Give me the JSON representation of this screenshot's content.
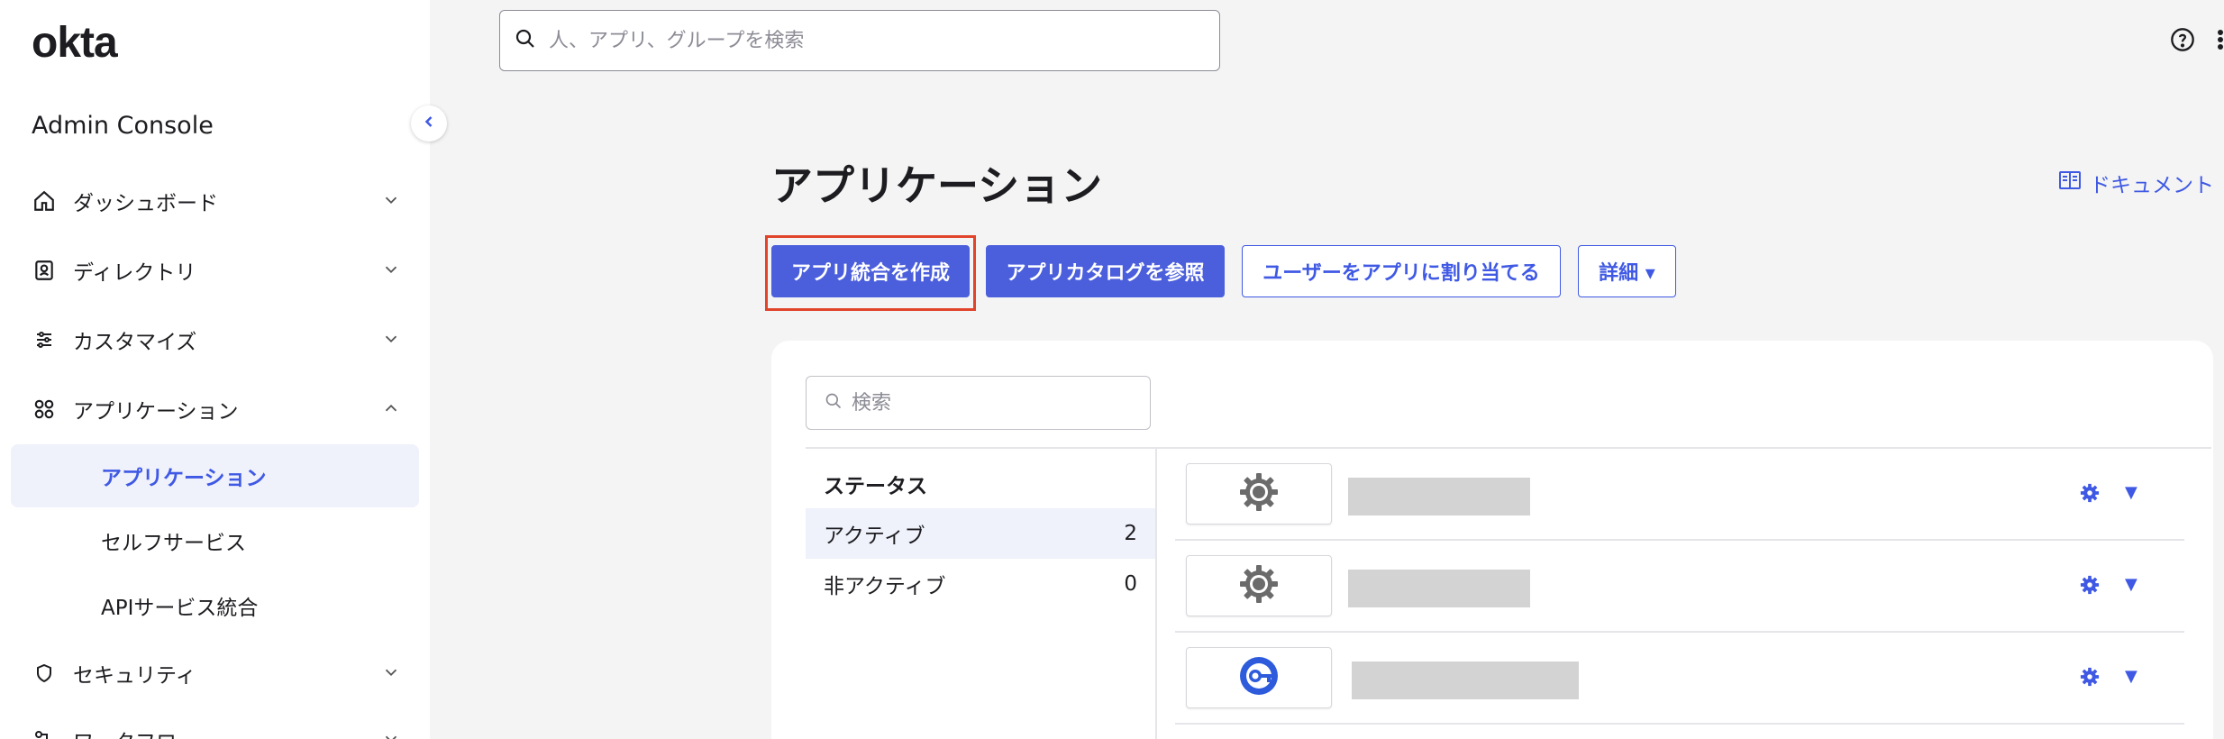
{
  "brand": {
    "logo_text": "okta",
    "console_title": "Admin Console"
  },
  "sidebar": {
    "items": [
      {
        "label": "ダッシュボード",
        "icon": "home-icon",
        "expanded": false
      },
      {
        "label": "ディレクトリ",
        "icon": "directory-icon",
        "expanded": false
      },
      {
        "label": "カスタマイズ",
        "icon": "sliders-icon",
        "expanded": false
      },
      {
        "label": "アプリケーション",
        "icon": "apps-grid-icon",
        "expanded": true
      },
      {
        "label": "セキュリティ",
        "icon": "shield-icon",
        "expanded": false
      },
      {
        "label": "ワークフロー",
        "icon": "workflow-icon",
        "expanded": false
      }
    ],
    "sub_items": [
      {
        "label": "アプリケーション",
        "active": true
      },
      {
        "label": "セルフサービス",
        "active": false
      },
      {
        "label": "APIサービス統合",
        "active": false
      }
    ]
  },
  "search": {
    "placeholder": "人、アプリ、グループを検索"
  },
  "page": {
    "title": "アプリケーション",
    "doc_link": "ドキュメント",
    "buttons": {
      "create": "アプリ統合を作成",
      "browse": "アプリカタログを参照",
      "assign": "ユーザーをアプリに割り当てる",
      "more": "詳細 ▾"
    }
  },
  "apps_panel": {
    "search_placeholder": "検索",
    "status_title": "ステータス",
    "statuses": [
      {
        "label": "アクティブ",
        "count": "2"
      },
      {
        "label": "非アクティブ",
        "count": "0"
      }
    ],
    "apps": [
      {
        "logo": "gear-icon"
      },
      {
        "logo": "gear-icon"
      },
      {
        "logo": "okta-key-icon"
      }
    ]
  },
  "colors": {
    "accent": "#4b5fdc",
    "link": "#3f59e4",
    "highlight": "#e0442b"
  }
}
